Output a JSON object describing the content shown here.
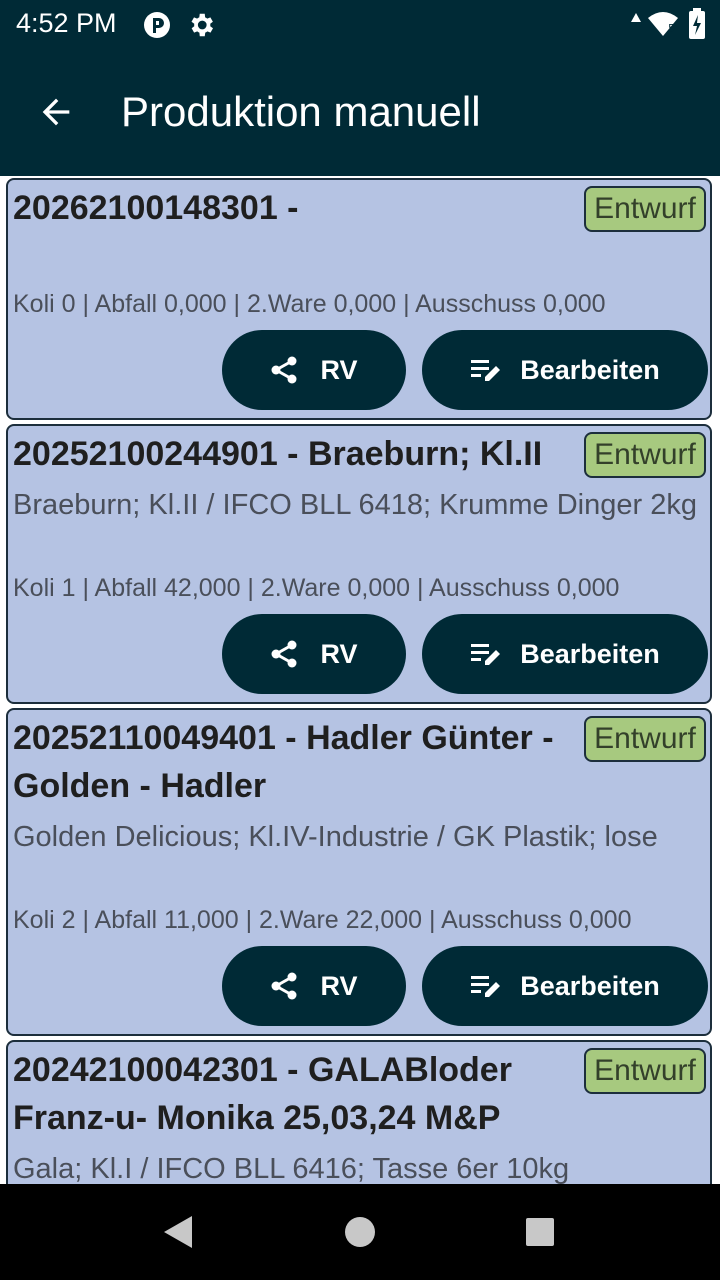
{
  "status_bar": {
    "time": "4:52 PM"
  },
  "app_bar": {
    "title": "Produktion manuell"
  },
  "cards": [
    {
      "title": "20262100148301 -",
      "badge": "Entwurf",
      "description": "",
      "stats": "Koli 0 | Abfall 0,000 | 2.Ware 0,000 | Ausschuss 0,000",
      "rv_label": "RV",
      "edit_label": "Bearbeiten"
    },
    {
      "title": "20252100244901 - Braeburn; Kl.II",
      "badge": "Entwurf",
      "description": "Braeburn; Kl.II / IFCO BLL 6418; Krumme Dinger 2kg",
      "stats": "Koli 1 | Abfall 42,000 | 2.Ware 0,000 | Ausschuss 0,000",
      "rv_label": "RV",
      "edit_label": "Bearbeiten"
    },
    {
      "title": "20252110049401 - Hadler Günter - Golden - Hadler",
      "badge": "Entwurf",
      "description": "Golden Delicious; Kl.IV-Industrie / GK Plastik; lose",
      "stats": "Koli 2 | Abfall 11,000 | 2.Ware 22,000 | Ausschuss 0,000",
      "rv_label": "RV",
      "edit_label": "Bearbeiten"
    },
    {
      "title": "20242100042301 - GALABloder Franz-u- Monika 25,03,24 M&P",
      "badge": "Entwurf",
      "description": "Gala; Kl.I / IFCO BLL 6416; Tasse 6er 10kg"
    }
  ],
  "colors": {
    "header": "#002a36",
    "card_bg": "#b5c3e3",
    "badge_bg": "#a7c97f",
    "button_bg": "#002a36"
  }
}
